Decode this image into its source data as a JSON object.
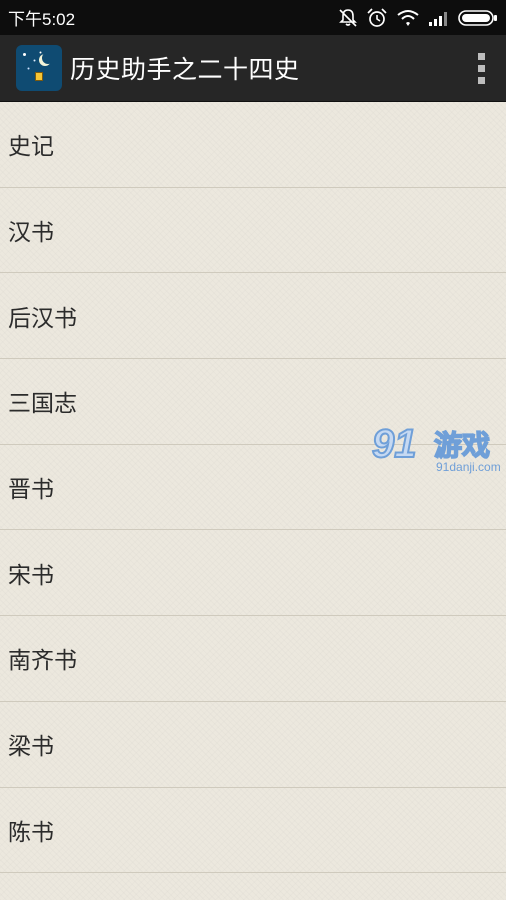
{
  "status_bar": {
    "time": "下午5:02",
    "icons": [
      "notifications-off-icon",
      "alarm-icon",
      "wifi-icon",
      "signal-icon",
      "battery-icon"
    ]
  },
  "action_bar": {
    "title": "历史助手之二十四史",
    "app_icon": "app-logo-icon",
    "menu_icon": "overflow-menu-icon"
  },
  "books": [
    {
      "label": "史记"
    },
    {
      "label": "汉书"
    },
    {
      "label": "后汉书"
    },
    {
      "label": "三国志"
    },
    {
      "label": "晋书"
    },
    {
      "label": "宋书"
    },
    {
      "label": "南齐书"
    },
    {
      "label": "梁书"
    },
    {
      "label": "陈书"
    }
  ],
  "watermark": {
    "logo": "91",
    "text": "游戏",
    "url": "91danji.com"
  },
  "colors": {
    "status_bar": "#0d0d0d",
    "action_bar": "#262626",
    "list_background": "#ece8de",
    "divider": "#cfcabd",
    "watermark": "#6f9fd8"
  }
}
